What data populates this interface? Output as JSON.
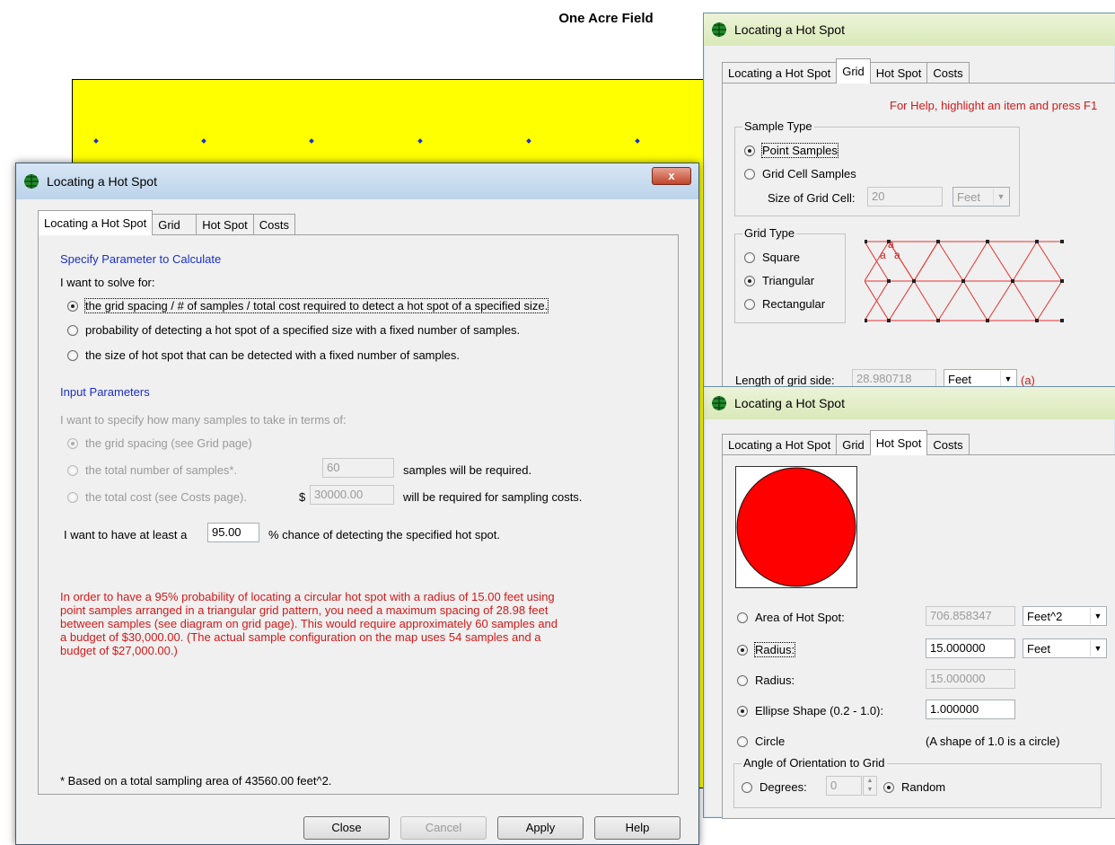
{
  "background_map": {
    "title": "One Acre Field",
    "field_color": "#ffff00",
    "sample_point_color": "#1a2fd6"
  },
  "main_dialog": {
    "title": "Locating a Hot Spot",
    "close_glyph": "x",
    "tabs": [
      "Locating a Hot Spot",
      "Grid",
      "Hot Spot",
      "Costs"
    ],
    "active_tab": "Locating a Hot Spot",
    "specify_heading": "Specify Parameter to Calculate",
    "solve_for_label": "I want to solve for:",
    "solve_options": [
      "the grid spacing / # of samples / total cost required to detect a hot spot of a specified size.",
      "probability of detecting a hot spot of a specified size with a fixed number of samples.",
      "the size of hot spot that can be detected with a fixed number of samples."
    ],
    "input_params_heading": "Input Parameters",
    "specify_how_label": "I want to specify how many samples to take in terms of:",
    "spec_options": [
      "the grid spacing (see Grid page)",
      "the total number of samples*.",
      "the total cost (see Costs page)."
    ],
    "samples_value": "60",
    "samples_suffix": "samples will be required.",
    "dollar_sign": "$",
    "cost_value": "30000.00",
    "cost_suffix": "will be required for sampling costs.",
    "chance_prefix": "I want to have at least a",
    "chance_value": "95.00",
    "chance_suffix": "% chance of detecting the specified hot spot.",
    "result_text": [
      "In order to have a 95% probability of locating a circular hot spot with a radius of 15.00 feet using",
      "point samples arranged in a triangular grid pattern, you need a maximum spacing of 28.98 feet",
      "between samples (see diagram on grid page).  This would require approximately 60 samples and",
      "a budget of $30,000.00.  (The actual sample configuration on the map uses 54 samples and a",
      "budget of $27,000.00.)"
    ],
    "footnote": "* Based on a total sampling area of 43560.00 feet^2.",
    "buttons": {
      "close": "Close",
      "cancel": "Cancel",
      "apply": "Apply",
      "help": "Help"
    }
  },
  "grid_dialog": {
    "title": "Locating a Hot Spot",
    "tabs": [
      "Locating a Hot Spot",
      "Grid",
      "Hot Spot",
      "Costs"
    ],
    "active_tab": "Grid",
    "help_text": "For Help, highlight an item and press F1",
    "sample_type_title": "Sample Type",
    "sample_types": [
      "Point Samples",
      "Grid Cell Samples"
    ],
    "size_of_cell_label": "Size of Grid Cell:",
    "size_of_cell_value": "20",
    "size_unit": "Feet",
    "grid_type_title": "Grid Type",
    "grid_types": [
      "Square",
      "Triangular",
      "Rectangular"
    ],
    "diagram_label": "a",
    "length_label": "Length of grid side:",
    "length_value": "28.980718",
    "length_unit": "Feet",
    "length_marker": "(a)"
  },
  "hotspot_dialog": {
    "title": "Locating a Hot Spot",
    "tabs": [
      "Locating a Hot Spot",
      "Grid",
      "Hot Spot",
      "Costs"
    ],
    "active_tab": "Hot Spot",
    "hotspot_color": "#ff0000",
    "area_label": "Area of Hot Spot:",
    "area_value": "706.858347",
    "area_unit": "Feet^2",
    "radius_label": "Radius:",
    "radius_value": "15.000000",
    "radius_unit": "Feet",
    "radius2_label": "Radius:",
    "radius2_value": "15.000000",
    "ellipse_label": "Ellipse  Shape (0.2 - 1.0):",
    "ellipse_value": "1.000000",
    "circle_label": "Circle",
    "circle_note": "(A shape of 1.0 is a circle)",
    "angle_title": "Angle of Orientation to Grid",
    "degrees_label": "Degrees:",
    "degrees_value": "0",
    "random_label": "Random"
  }
}
